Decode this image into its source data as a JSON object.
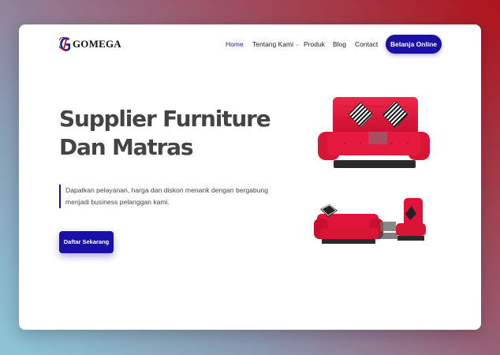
{
  "brand": {
    "name": "GOMEGA",
    "logo_icon": "gomega-logo-icon"
  },
  "nav": {
    "items": [
      {
        "label": "Home",
        "active": true
      },
      {
        "label": "Tentang Kami",
        "has_dropdown": true
      },
      {
        "label": "Produk"
      },
      {
        "label": "Blog"
      },
      {
        "label": "Contact"
      }
    ],
    "cta_label": "Belanja Online"
  },
  "hero": {
    "title": "Supplier Furniture Dan Matras",
    "description": "Dapatkan pelayanan, harga dan diskon menarik dengan bergabung menjadi business pelanggan kami.",
    "cta_label": "Daftar Sekarang"
  },
  "colors": {
    "primary": "#1a0fa6",
    "heading": "#444444",
    "sofa_red": "#e0133a"
  }
}
